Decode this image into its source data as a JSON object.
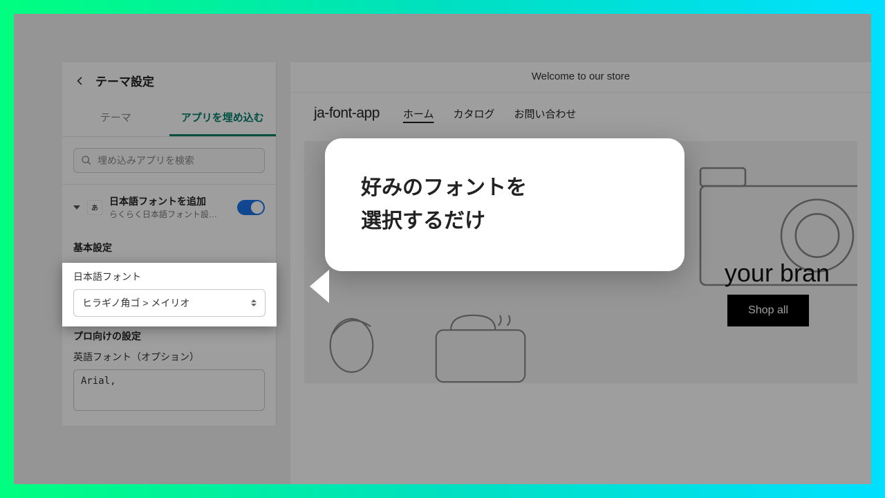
{
  "sidebar": {
    "title": "テーマ設定",
    "tabs": {
      "theme": "テーマ",
      "embed": "アプリを埋め込む"
    },
    "search_placeholder": "埋め込みアプリを検索",
    "app": {
      "title": "日本語フォントを追加",
      "subtitle": "らくらく日本語フォント設定 | ..."
    },
    "sections": {
      "basic_title": "基本設定",
      "font_label": "日本語フォント",
      "font_value": "ヒラギノ角ゴ > メイリオ",
      "pro_title": "プロ向けの設定",
      "en_label": "英語フォント（オプション）",
      "en_value": "Arial,"
    }
  },
  "preview": {
    "announce": "Welcome to our store",
    "logo": "ja-font-app",
    "nav": {
      "home": "ホーム",
      "catalog": "カタログ",
      "contact": "お問い合わせ"
    },
    "tagline": "your bran",
    "cta": "Shop all"
  },
  "tooltip": {
    "line1": "好みのフォントを",
    "line2": "選択するだけ"
  }
}
